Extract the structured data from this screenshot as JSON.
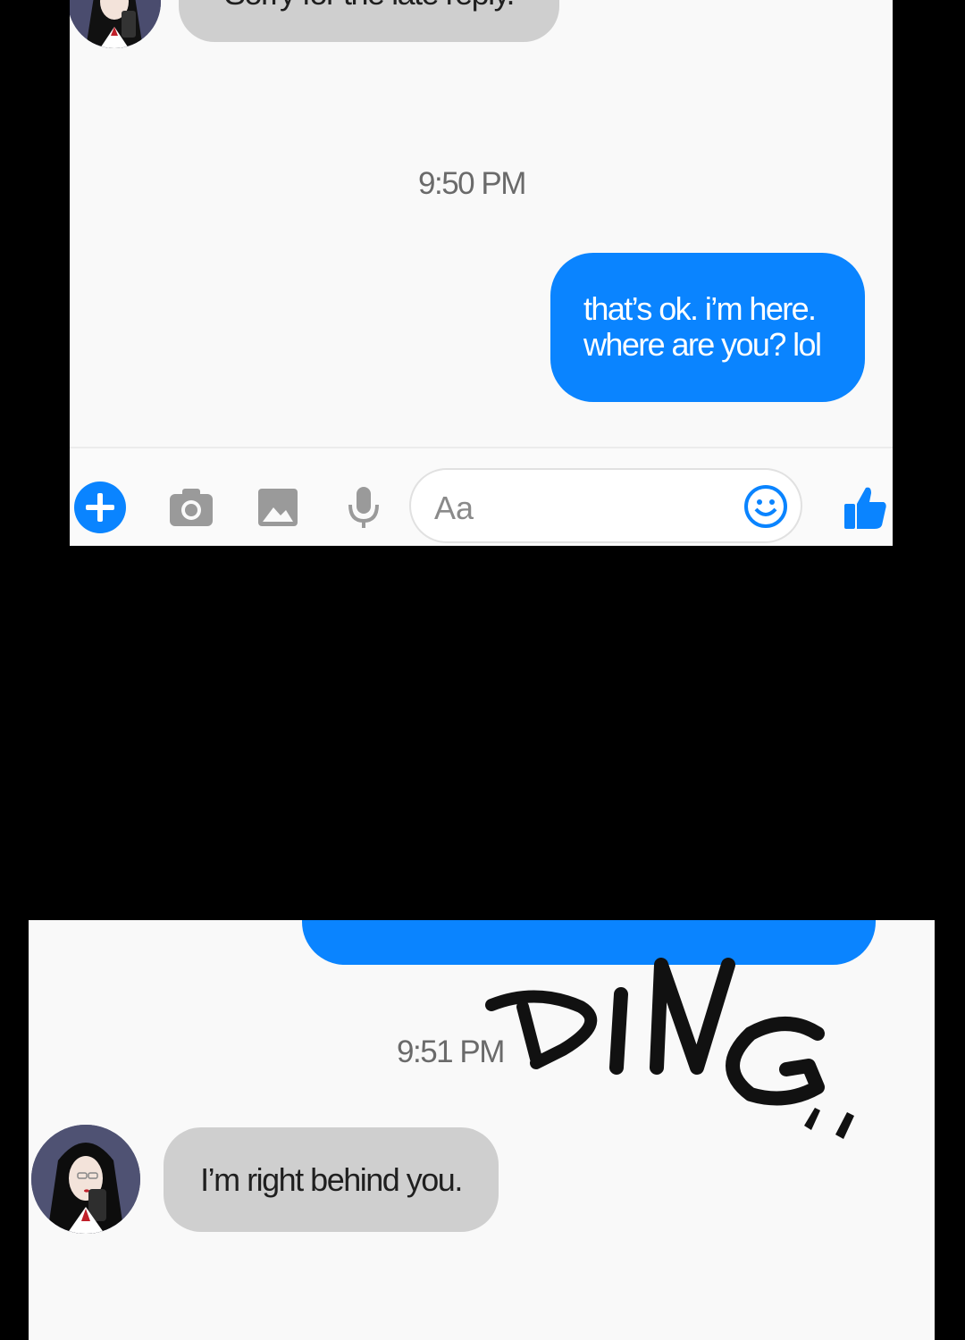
{
  "panel1": {
    "top_message_partial": "Sorry for the late reply.",
    "timestamp": "9:50 PM",
    "outgoing": {
      "line1": "that’s ok. i’m here.",
      "line2": "where are you? lol"
    },
    "composer": {
      "placeholder": "Aa",
      "icons": [
        "add-icon",
        "camera-icon",
        "image-icon",
        "microphone-icon",
        "emoji-icon",
        "thumbs-up-icon"
      ]
    }
  },
  "panel2": {
    "timestamp": "9:51 PM",
    "incoming": "I’m right behind you.",
    "sfx": "DING.."
  },
  "colors": {
    "accent": "#0a84ff",
    "incoming_bubble": "#cfcfcf",
    "background": "#f9f9f9"
  }
}
